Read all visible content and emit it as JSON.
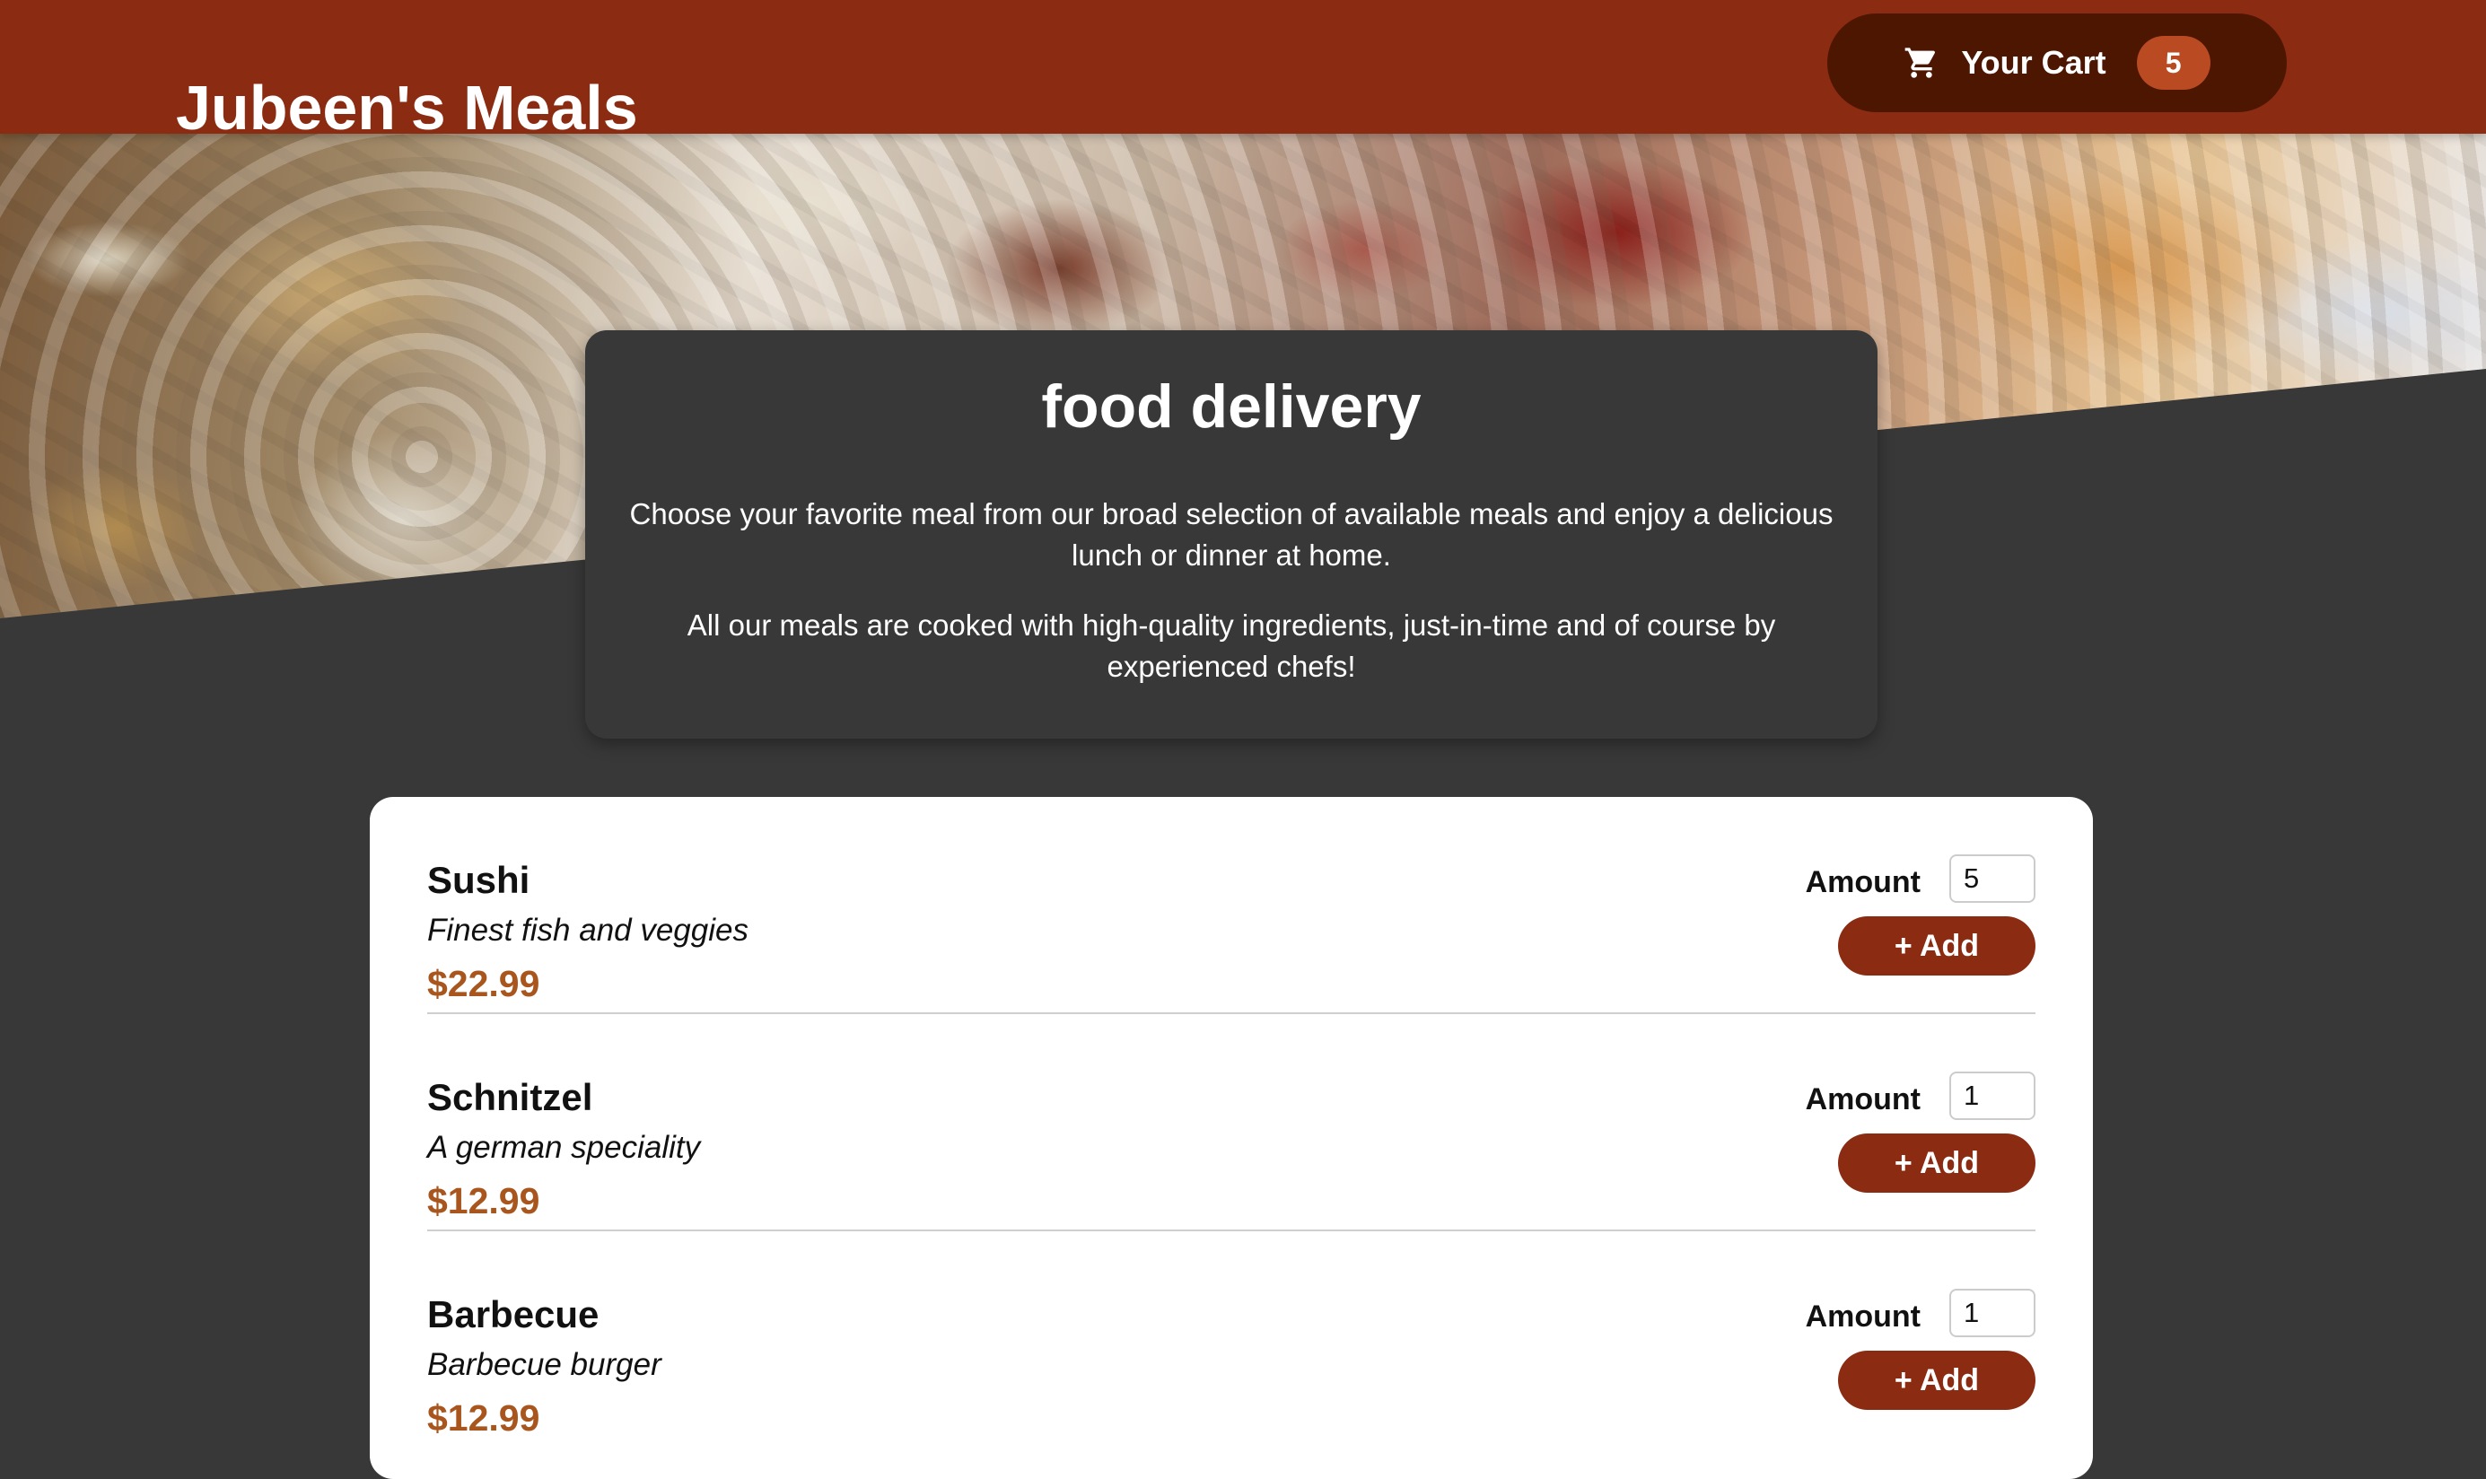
{
  "header": {
    "brand": "Jubeen's Meals",
    "cart_label": "Your Cart",
    "cart_count": "5",
    "cart_icon": "shopping-cart-icon"
  },
  "hero": {
    "image": "buffet-table-photo"
  },
  "summary": {
    "title": "food delivery",
    "paragraph_1": "Choose your favorite meal from our broad selection of available meals and enjoy a delicious lunch or dinner at home.",
    "paragraph_2": "All our meals are cooked with high-quality ingredients, just-in-time and of course by experienced chefs!"
  },
  "meals": {
    "items": [
      {
        "name": "Sushi",
        "description": "Finest fish and veggies",
        "price": "$22.99",
        "amount_label": "Amount",
        "amount": "5",
        "add_label": "+ Add"
      },
      {
        "name": "Schnitzel",
        "description": "A german speciality",
        "price": "$12.99",
        "amount_label": "Amount",
        "amount": "1",
        "add_label": "+ Add"
      },
      {
        "name": "Barbecue",
        "description": "Barbecue burger",
        "price": "$12.99",
        "amount_label": "Amount",
        "amount": "1",
        "add_label": "+ Add"
      }
    ]
  },
  "colors": {
    "header_bg": "#8a2b12",
    "cart_bg": "#4d1601",
    "badge_bg": "#b94a21",
    "page_bg": "#383838",
    "price": "#a8561e"
  }
}
